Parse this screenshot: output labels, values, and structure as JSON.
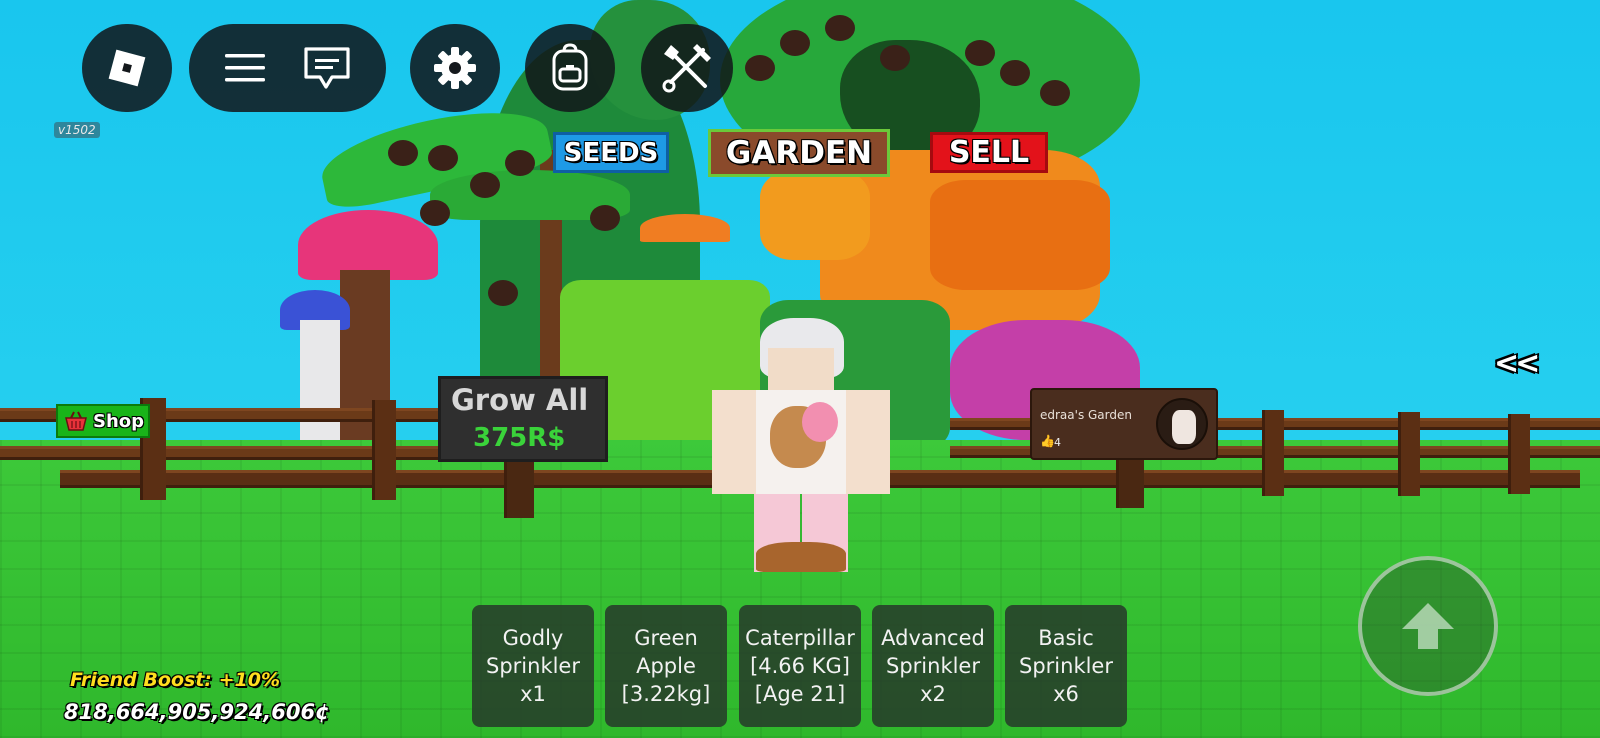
{
  "topbar": {
    "version": "v1502",
    "icons": [
      "roblox-logo-icon",
      "menu-icon",
      "chat-icon",
      "gear-icon",
      "backpack-icon",
      "tools-icon"
    ]
  },
  "nav": {
    "seeds": "SEEDS",
    "garden": "GARDEN",
    "sell": "SELL",
    "colors": {
      "seeds": "#1e9ae6",
      "garden": "#8a4a2b",
      "sell": "#e3121a"
    }
  },
  "shop": {
    "label": "Shop"
  },
  "grow_sign": {
    "title": "Grow All",
    "price": "375R$"
  },
  "garden_sign": {
    "owner": "edraa's Garden",
    "likes": "4"
  },
  "hotbar": [
    {
      "lines": [
        "Godly",
        "Sprinkler",
        "x1"
      ]
    },
    {
      "lines": [
        "Green",
        "Apple",
        "[3.22kg]"
      ]
    },
    {
      "lines": [
        "Caterpillar",
        "[4.66 KG]",
        "[Age 21]"
      ]
    },
    {
      "lines": [
        "Advanced",
        "Sprinkler",
        "x2"
      ]
    },
    {
      "lines": [
        "Basic",
        "Sprinkler",
        "x6"
      ]
    }
  ],
  "collapse_label": "<<",
  "status": {
    "friend_boost": "Friend Boost: +10%",
    "money": "818,664,905,924,606¢"
  }
}
